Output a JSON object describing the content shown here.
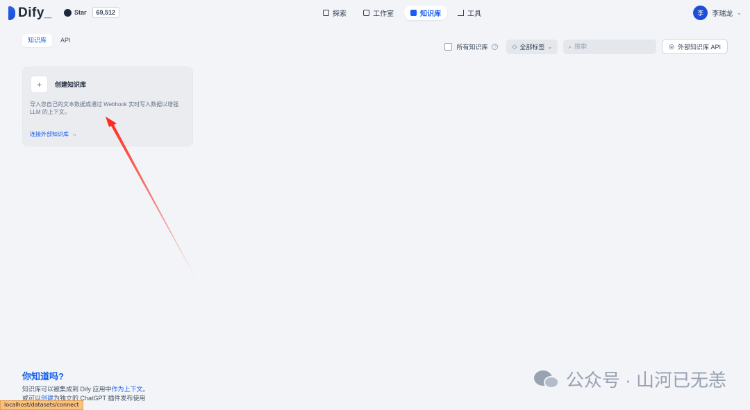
{
  "header": {
    "logo_text": "Dify",
    "github_star_label": "Star",
    "github_star_count": "69,512",
    "nav": [
      {
        "label": "探索",
        "icon": "compass-icon"
      },
      {
        "label": "工作室",
        "icon": "robot-icon"
      },
      {
        "label": "知识库",
        "icon": "book-icon",
        "active": true
      },
      {
        "label": "工具",
        "icon": "hammer-icon"
      }
    ],
    "user": {
      "avatar_initial": "李",
      "name": "李瑞龙"
    }
  },
  "subheader": {
    "tabs": [
      {
        "label": "知识库",
        "active": true
      },
      {
        "label": "API",
        "active": false
      }
    ],
    "all_kb_label": "所有知识库",
    "tags_label": "全部标签",
    "search_placeholder": "搜索",
    "external_api_label": "外部知识库 API"
  },
  "create_card": {
    "title": "创建知识库",
    "description": "导入您自己的文本数据或通过 Webhook 实时写入数据以增强 LLM 的上下文。",
    "link_label": "连接外部知识库"
  },
  "tip": {
    "title": "你知道吗?",
    "line1_a": "知识库可以被集成到 Dify 应用中",
    "line1_b": "作为上下文",
    "line1_c": "。",
    "line2_a": "或可以",
    "line2_b": "创建",
    "line2_c": "为独立的 ChatGPT 插件发布使用"
  },
  "statusbar_url": "localhost/datasets/connect",
  "watermark_text": "公众号 · 山河已无恙",
  "colors": {
    "accent": "#155eef",
    "annotation_arrow": "#ff2a1f"
  }
}
